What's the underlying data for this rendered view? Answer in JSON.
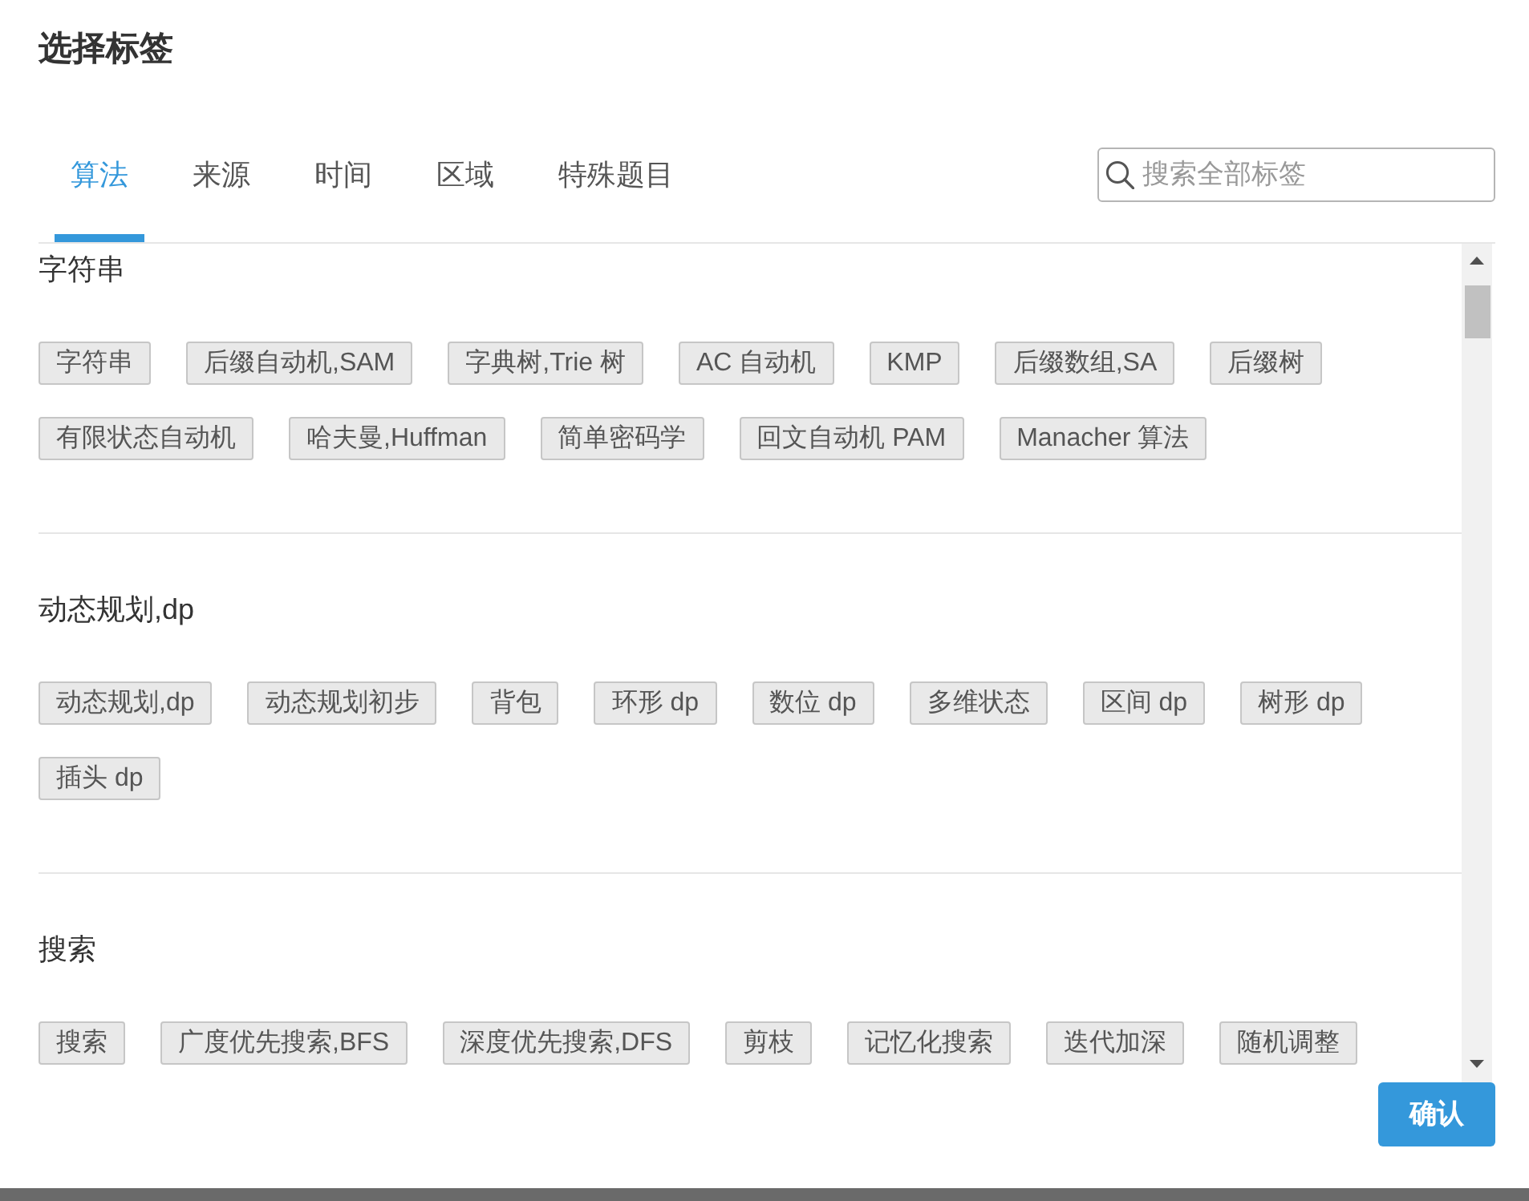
{
  "dialog": {
    "title": "选择标签"
  },
  "tabs": [
    {
      "label": "算法",
      "selected": true
    },
    {
      "label": "来源",
      "selected": false
    },
    {
      "label": "时间",
      "selected": false
    },
    {
      "label": "区域",
      "selected": false
    },
    {
      "label": "特殊题目",
      "selected": false
    }
  ],
  "search": {
    "placeholder": "搜索全部标签"
  },
  "sections": [
    {
      "heading": "字符串",
      "tags": [
        "字符串",
        "后缀自动机,SAM",
        "字典树,Trie 树",
        "AC 自动机",
        "KMP",
        "后缀数组,SA",
        "后缀树",
        "有限状态自动机",
        "哈夫曼,Huffman",
        "简单密码学",
        "回文自动机 PAM",
        "Manacher 算法"
      ]
    },
    {
      "heading": "动态规划,dp",
      "tags": [
        "动态规划,dp",
        "动态规划初步",
        "背包",
        "环形 dp",
        "数位 dp",
        "多维状态",
        "区间 dp",
        "树形 dp",
        "插头 dp"
      ]
    },
    {
      "heading": "搜索",
      "tags": [
        "搜索",
        "广度优先搜索,BFS",
        "深度优先搜索,DFS",
        "剪枝",
        "记忆化搜索",
        "迭代加深",
        "随机调整"
      ]
    }
  ],
  "confirm_button": {
    "label": "确认"
  }
}
